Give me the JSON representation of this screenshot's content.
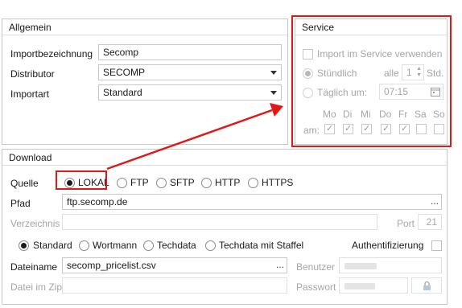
{
  "allgemein": {
    "title": "Allgemein",
    "importbezeichnung_label": "Importbezeichnung",
    "importbezeichnung_value": "Secomp",
    "distributor_label": "Distributor",
    "distributor_value": "SECOMP",
    "importart_label": "Importart",
    "importart_value": "Standard"
  },
  "service": {
    "title": "Service",
    "import_checkbox_label": "Import im Service verwenden",
    "hourly_label": "Stündlich",
    "every_label": "alle",
    "every_value": "1",
    "hours_unit": "Std.",
    "daily_label": "Täglich um:",
    "time_value": "07:15",
    "days": [
      "Mo",
      "Di",
      "Mi",
      "Do",
      "Fr",
      "Sa",
      "So"
    ],
    "am_label": "am:"
  },
  "download": {
    "title": "Download",
    "quelle_label": "Quelle",
    "sources": [
      "LOKAL",
      "FTP",
      "SFTP",
      "HTTP",
      "HTTPS"
    ],
    "selected_source": "LOKAL",
    "pfad_label": "Pfad",
    "pfad_value": "ftp.secomp.de",
    "verzeichnis_label": "Verzeichnis",
    "port_label": "Port",
    "port_value": "21",
    "modes": [
      "Standard",
      "Wortmann",
      "Techdata",
      "Techdata mit Staffel"
    ],
    "selected_mode": "Standard",
    "auth_label": "Authentifizierung",
    "dateiname_label": "Dateiname",
    "dateiname_value": "secomp_pricelist.csv",
    "datei_im_zip_label": "Datei im Zip",
    "benutzer_label": "Benutzer",
    "passwort_label": "Passwort",
    "ellipsis": "..."
  },
  "colors": {
    "highlight": "#e01818",
    "border": "#c8c8c8",
    "disabled_text": "#a6a6a6"
  }
}
